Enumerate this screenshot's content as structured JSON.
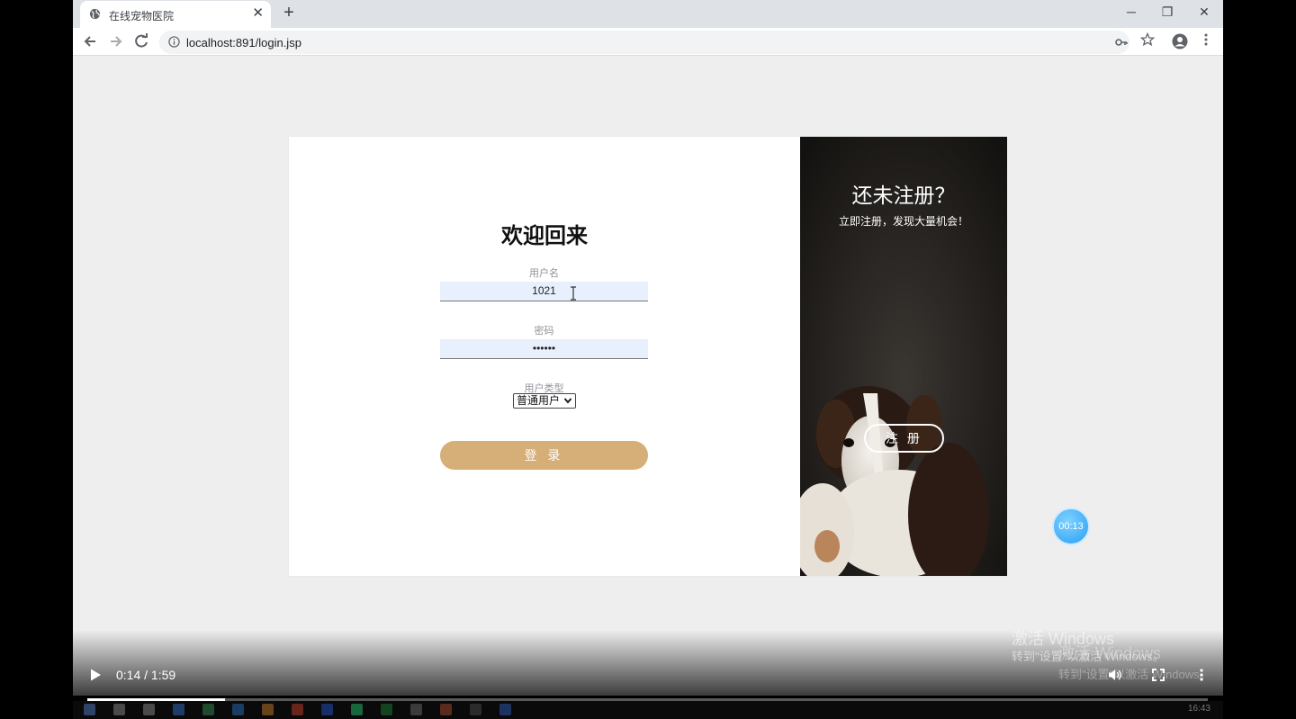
{
  "browser": {
    "tab_title": "在线宠物医院",
    "tab_close": "✕",
    "new_tab": "+",
    "url": "localhost:891/login.jsp",
    "window_buttons": [
      "─",
      "❐",
      "✕"
    ]
  },
  "login": {
    "heading": "欢迎回来",
    "username_label": "用户名",
    "username_value": "1021",
    "password_label": "密码",
    "password_value": "••••••",
    "usertype_label": "用户类型",
    "usertype_selected": "普通用户",
    "login_button": "登 录"
  },
  "side": {
    "title": "还未注册？",
    "subtitle": "立即注册，发现大量机会！",
    "register_button": "注 册"
  },
  "recorder": {
    "timer": "00:13"
  },
  "video": {
    "time": "0:14 / 1:59",
    "progress": 0.123
  },
  "watermark": {
    "line1": "激活 Windows",
    "line2": "转到\"设置\"以激活 Windows。",
    "line3": "激活 Windows",
    "line4": "转到\"设置\"以激活 Windows。"
  },
  "taskbar": {
    "clock": "16:43"
  }
}
